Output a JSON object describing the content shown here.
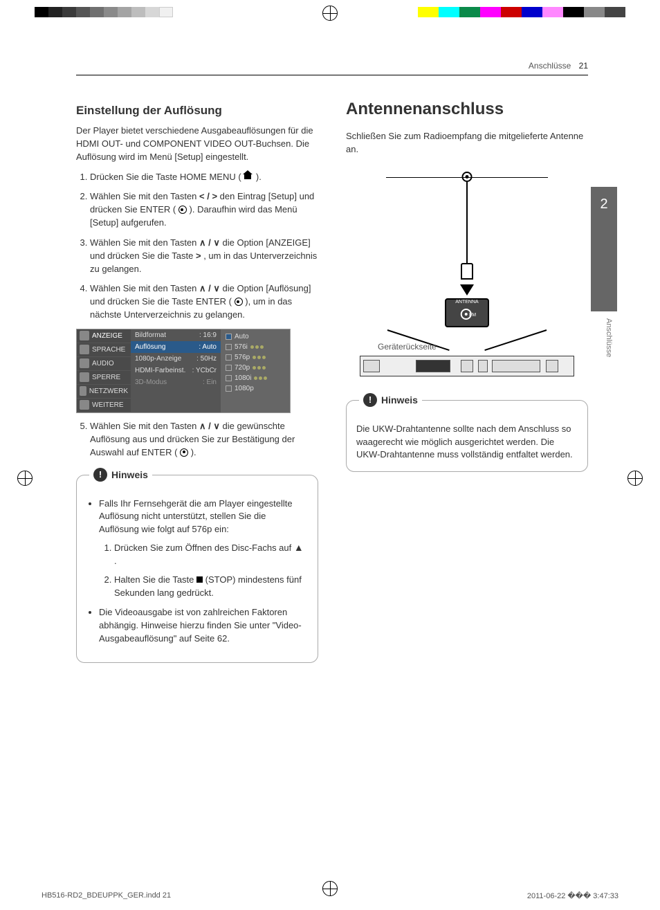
{
  "header": {
    "section": "Anschlüsse",
    "page_number": "21"
  },
  "side_tab": {
    "chapter": "2",
    "label": "Anschlüsse"
  },
  "left": {
    "h2": "Einstellung der Auflösung",
    "intro": "Der Player bietet verschiedene Ausgabeauflösungen für die HDMI OUT- und COMPONENT VIDEO OUT-Buchsen. Die Auflösung wird im Menü [Setup] eingestellt.",
    "steps": {
      "1_a": "Drücken Sie die Taste HOME MENU (",
      "1_b": ").",
      "2_a": "Wählen Sie mit den Tasten ",
      "2_b": " den Eintrag [Setup] und drücken Sie ENTER (",
      "2_c": "). Daraufhin wird das Menü [Setup] aufgerufen.",
      "3_a": "Wählen Sie mit den Tasten ",
      "3_b": " die Option [ANZEIGE] und drücken Sie die Taste ",
      "3_c": ", um in das Unterverzeichnis zu gelangen.",
      "4_a": "Wählen Sie mit den Tasten ",
      "4_b": " die Option [Auflösung] und drücken Sie die Taste ENTER (",
      "4_c": "), um in das nächste Unterverzeichnis zu gelangen.",
      "5_a": "Wählen Sie mit den Tasten ",
      "5_b": " die gewünschte Auflösung aus und drücken Sie zur Bestätigung der Auswahl auf ENTER (",
      "5_c": ")."
    },
    "osd": {
      "menu": [
        "ANZEIGE",
        "SPRACHE",
        "AUDIO",
        "SPERRE",
        "NETZWERK",
        "WEITERE"
      ],
      "items": [
        {
          "label": "Bildformat",
          "value": ": 16:9"
        },
        {
          "label": "Auflösung",
          "value": ": Auto"
        },
        {
          "label": "1080p-Anzeige",
          "value": ": 50Hz"
        },
        {
          "label": "HDMI-Farbeinst.",
          "value": ": YCbCr"
        },
        {
          "label": "3D-Modus",
          "value": ": Ein"
        }
      ],
      "options": [
        "Auto",
        "576i",
        "576p",
        "720p",
        "1080i",
        "1080p"
      ]
    },
    "note": {
      "title": "Hinweis",
      "b1": "Falls Ihr Fernsehgerät die am Player eingestellte Auflösung nicht unterstützt, stellen Sie die Auflösung wie folgt auf 576p ein:",
      "sub1_a": "Drücken Sie zum Öffnen des Disc-Fachs auf ",
      "sub1_b": ".",
      "sub2_a": "Halten Sie die Taste ",
      "sub2_b": " (STOP) mindestens fünf Sekunden lang gedrückt.",
      "b2": "Die Videoausgabe ist von zahlreichen Faktoren abhängig. Hinweise hierzu finden Sie unter \"Video-Ausgabeauflösung\" auf Seite 62."
    }
  },
  "right": {
    "h1": "Antennenanschluss",
    "intro": "Schließen Sie zum Radioempfang die mitgelieferte Antenne an.",
    "fig": {
      "rear_label": "Geräterückseite",
      "jack_label": "ANTENNA",
      "fm": "FM"
    },
    "note": {
      "title": "Hinweis",
      "text": "Die UKW-Drahtantenne sollte nach dem Anschluss so waagerecht wie möglich ausgerichtet werden. Die UKW-Drahtantenne muss vollständig entfaltet werden."
    }
  },
  "footer": {
    "file": "HB516-RD2_BDEUPPK_GER.indd   21",
    "timestamp": "2011-06-22   ��� 3:47:33"
  },
  "glyphs": {
    "lr": "< / >",
    "ud": "∧ / ∨",
    "right": ">",
    "eject": "▲"
  }
}
